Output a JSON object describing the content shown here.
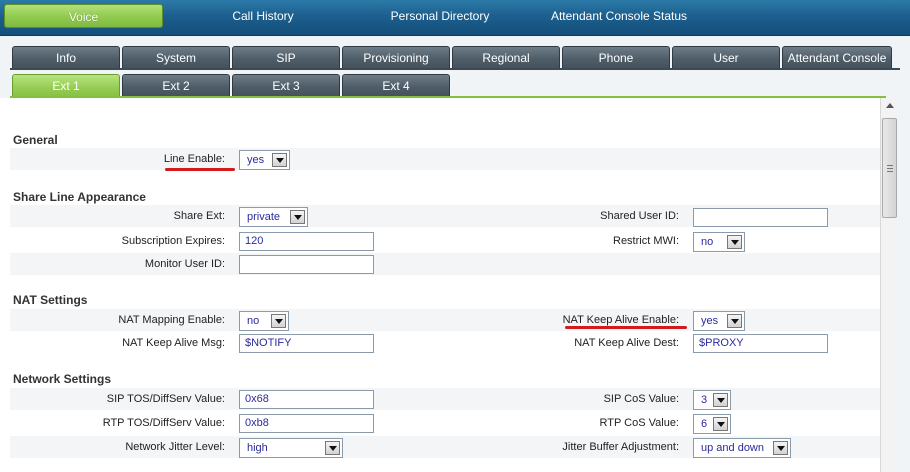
{
  "top_nav": [
    {
      "label": "Voice",
      "active": true
    },
    {
      "label": "Call History"
    },
    {
      "label": "Personal Directory"
    },
    {
      "label": "Attendant Console Status"
    }
  ],
  "main_tabs": [
    "Info",
    "System",
    "SIP",
    "Provisioning",
    "Regional",
    "Phone",
    "User",
    "Attendant Console"
  ],
  "ext_tabs": [
    "Ext 1",
    "Ext 2",
    "Ext 3",
    "Ext 4"
  ],
  "general": {
    "title": "General",
    "line_enable_label": "Line Enable:",
    "line_enable_value": "yes"
  },
  "share_line": {
    "title": "Share Line Appearance",
    "share_ext_label": "Share Ext:",
    "share_ext_value": "private",
    "shared_user_id_label": "Shared User ID:",
    "shared_user_id_value": "",
    "subscription_expires_label": "Subscription Expires:",
    "subscription_expires_value": "120",
    "restrict_mwi_label": "Restrict MWI:",
    "restrict_mwi_value": "no",
    "monitor_user_id_label": "Monitor User ID:",
    "monitor_user_id_value": ""
  },
  "nat": {
    "title": "NAT Settings",
    "nat_mapping_enable_label": "NAT Mapping Enable:",
    "nat_mapping_enable_value": "no",
    "nat_keep_alive_enable_label": "NAT Keep Alive Enable:",
    "nat_keep_alive_enable_value": "yes",
    "nat_keep_alive_msg_label": "NAT Keep Alive Msg:",
    "nat_keep_alive_msg_value": "$NOTIFY",
    "nat_keep_alive_dest_label": "NAT Keep Alive Dest:",
    "nat_keep_alive_dest_value": "$PROXY"
  },
  "network": {
    "title": "Network Settings",
    "sip_tos_label": "SIP TOS/DiffServ Value:",
    "sip_tos_value": "0x68",
    "sip_cos_label": "SIP CoS Value:",
    "sip_cos_value": "3",
    "rtp_tos_label": "RTP TOS/DiffServ Value:",
    "rtp_tos_value": "0xb8",
    "rtp_cos_label": "RTP CoS Value:",
    "rtp_cos_value": "6",
    "jitter_level_label": "Network Jitter Level:",
    "jitter_level_value": "high",
    "jitter_buffer_label": "Jitter Buffer Adjustment:",
    "jitter_buffer_value": "up and down"
  },
  "colors": {
    "active_green": "#93cc52",
    "tab_gray": "#4f5d68",
    "topbar_blue": "#1c5f8e",
    "annotation_red": "#d41b1b",
    "value_text": "#2a2aa0"
  }
}
